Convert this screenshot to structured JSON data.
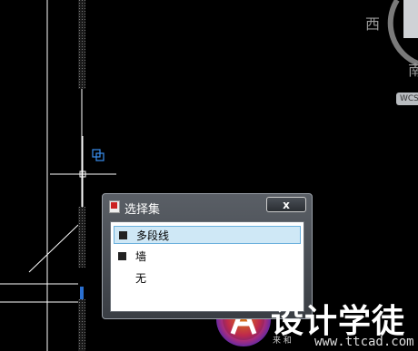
{
  "viewcube": {
    "west": "西",
    "south": "南",
    "wcs": "WCS"
  },
  "dialog": {
    "title": "选择集",
    "close": "x",
    "items": [
      {
        "label": "多段线",
        "selected": true,
        "swatch": true
      },
      {
        "label": "墙",
        "selected": false,
        "swatch": true
      },
      {
        "label": "无",
        "selected": false,
        "swatch": false
      }
    ]
  },
  "watermark": {
    "title": "设计学徒",
    "subtitle": "来  和",
    "url": "www.ttcad.com"
  },
  "colors": {
    "background": "#000000",
    "accent": "#2a6fd0"
  }
}
